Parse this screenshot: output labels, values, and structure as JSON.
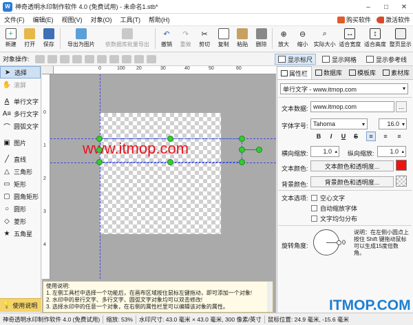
{
  "titlebar": {
    "title": "神奇透明水印制作软件 4.0 (免费试用) - 未命名1.stb*",
    "app_icon": "watermark-app-icon",
    "minimize": "–",
    "maximize": "□",
    "close": "✕"
  },
  "menu": {
    "items": [
      "文件(F)",
      "编辑(E)",
      "视图(V)",
      "对象(O)",
      "工具(T)",
      "帮助(H)"
    ],
    "buy": "购买软件",
    "activate": "激活软件"
  },
  "toolbar": {
    "items": [
      {
        "label": "新建",
        "icon": "new-file-icon"
      },
      {
        "label": "打开",
        "icon": "open-folder-icon"
      },
      {
        "label": "保存",
        "icon": "save-icon"
      },
      {
        "label": "导出为图片",
        "icon": "export-image-icon"
      },
      {
        "label": "依数据库批量导出",
        "icon": "batch-export-icon"
      },
      {
        "label": "撤销",
        "icon": "undo-icon"
      },
      {
        "label": "重做",
        "icon": "redo-icon"
      },
      {
        "label": "剪切",
        "icon": "cut-icon"
      },
      {
        "label": "复制",
        "icon": "copy-icon"
      },
      {
        "label": "粘贴",
        "icon": "paste-icon"
      },
      {
        "label": "删除",
        "icon": "delete-icon"
      },
      {
        "label": "放大",
        "icon": "zoom-in-icon"
      },
      {
        "label": "缩小",
        "icon": "zoom-out-icon"
      },
      {
        "label": "实际大小",
        "icon": "actual-size-icon"
      },
      {
        "label": "适合宽度",
        "icon": "fit-width-icon"
      },
      {
        "label": "适合高度",
        "icon": "fit-height-icon"
      },
      {
        "label": "整页显示",
        "icon": "full-page-icon"
      }
    ]
  },
  "objbar": {
    "label": "对象操作:",
    "show_ruler": "显示标尺",
    "show_grid": "显示网格",
    "show_guides": "显示参考线"
  },
  "tools": {
    "select": "选择",
    "scroll": "滚屏",
    "single_text": "单行文字",
    "multi_text": "多行文字",
    "arc_text": "圆弧文字",
    "image": "图片",
    "line": "直线",
    "triangle": "三角形",
    "rect": "矩形",
    "round_rect": "圆角矩形",
    "circle": "圆形",
    "diamond": "菱形",
    "star": "五角星",
    "help": "使用说明"
  },
  "ruler": {
    "top": [
      "0",
      "100",
      "20",
      "30",
      "40",
      "50",
      "60"
    ],
    "left": [
      "0",
      "1",
      "2",
      "3",
      "4"
    ]
  },
  "canvas": {
    "watermark_text": "www.itmop.com",
    "text_color": "#e8141e"
  },
  "help": {
    "title": "使用说明:",
    "lines": [
      "1. 左侧工具栏中选择一个功能后，在画布区域按住鼠标左键拖动，即可添加一个对象!",
      "2. 水印中的单行文字、多行文字、圆弧文字对象均可以双击修改!",
      "3. 选择水印中的任意一个对象，在右侧的属性栏里可以编辑该对象的属性。"
    ]
  },
  "panel": {
    "tabs": [
      "属性栏",
      "数据库",
      "模板库",
      "素材库"
    ],
    "object": "单行文字 - www.itmop.com",
    "text_data_label": "文本数据:",
    "text_data": "www.itmop.com",
    "edit_btn": "...",
    "font_label": "字体字号:",
    "font": "Tahoma",
    "size": "16.0",
    "fmt": [
      "B",
      "I",
      "U",
      "S"
    ],
    "hscale_label": "横向缩放:",
    "hscale": "1.0",
    "vscale_label": "纵向缩放:",
    "vscale": "1.0",
    "textcolor_label": "文本颜色:",
    "textcolor_btn": "文本颜色和透明度...",
    "textcolor_value": "#ee1111",
    "bgcolor_label": "背景颜色:",
    "bgcolor_btn": "背景颜色和透明度...",
    "options_label": "文本选项:",
    "opt_hollow": "空心文字",
    "opt_autoshrink": "自动缩放字体",
    "opt_justify": "文字均匀分布",
    "rotate_label": "旋转角度:",
    "rotate_value": "0",
    "rotate_note": "说明：在左侧小圆点上按住 Shift 键拖动鼠标可以生成15度倍数角。"
  },
  "status": {
    "zoom_label": "缩放:",
    "zoom": "53%",
    "size_label": "水印尺寸:",
    "size": "43.0 毫米 × 43.0 毫米, 300 像素/英寸",
    "pos_label": "鼠标位置:",
    "pos": "24.9 毫米, -15.6 毫米",
    "app": "神奇透明水印制作软件 4.0 (免费试用)"
  },
  "brand": "ITMOP.COM"
}
